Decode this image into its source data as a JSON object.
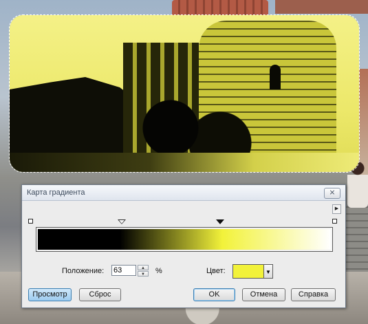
{
  "dialog": {
    "title": "Карта градиента",
    "close_label": "⨯",
    "menu_arrow": "▶"
  },
  "gradient": {
    "colors": [
      "#000000",
      "#f2f23a",
      "#ffffff"
    ],
    "color_positions": [
      0,
      63,
      100
    ]
  },
  "fields": {
    "position_label": "Положение:",
    "position_value": "63",
    "percent_label": "%",
    "color_label": "Цвет:",
    "color_value": "#f2f23a"
  },
  "buttons": {
    "preview": "Просмотр",
    "reset": "Сброс",
    "ok": "OK",
    "cancel": "Отмена",
    "help": "Справка"
  },
  "colors": {
    "selection_tint": "#f2f07f",
    "dialog_bg": "#ececec"
  }
}
